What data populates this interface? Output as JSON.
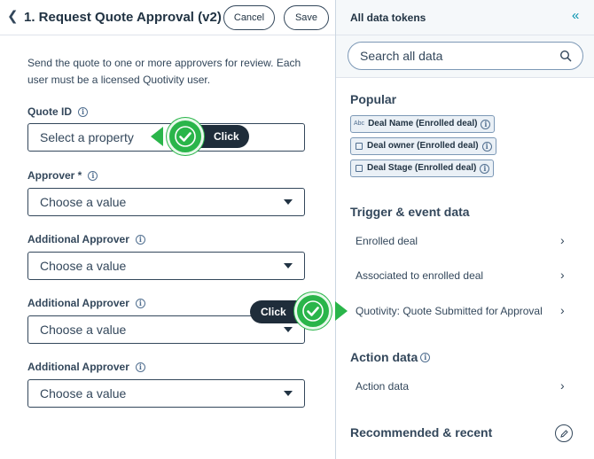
{
  "editor": {
    "title": "1. Request Quote Approval (v2)",
    "cancel_label": "Cancel",
    "save_label": "Save",
    "description": "Send the quote to one or more approvers for review. Each user must be a licensed Quotivity user.",
    "fields": [
      {
        "label": "Quote ID",
        "placeholder": "Select a property",
        "type": "property"
      },
      {
        "label": "Approver *",
        "placeholder": "Choose a value",
        "type": "dropdown"
      },
      {
        "label": "Additional Approver",
        "placeholder": "Choose a value",
        "type": "dropdown"
      },
      {
        "label": "Additional Approver",
        "placeholder": "Choose a value",
        "type": "dropdown"
      },
      {
        "label": "Additional Approver",
        "placeholder": "Choose a value",
        "type": "dropdown"
      }
    ]
  },
  "callouts": {
    "click_label": "Click"
  },
  "tokens_panel": {
    "title": "All data tokens",
    "search_placeholder": "Search all data",
    "popular": {
      "title": "Popular",
      "chips": [
        {
          "type_label": "Abc",
          "label": "Deal Name (Enrolled deal)"
        },
        {
          "type_label": "",
          "label": "Deal owner (Enrolled deal)"
        },
        {
          "type_label": "",
          "label": "Deal Stage (Enrolled deal)"
        }
      ]
    },
    "trigger": {
      "title": "Trigger & event data",
      "items": [
        {
          "label": "Enrolled deal"
        },
        {
          "label": "Associated to enrolled deal"
        },
        {
          "label": "Quotivity: Quote Submitted for Approval"
        }
      ]
    },
    "action": {
      "title": "Action data",
      "items": [
        {
          "label": "Action data"
        }
      ]
    },
    "recommended": {
      "title": "Recommended & recent"
    }
  },
  "colors": {
    "callout_green": "#2ab54a",
    "callout_dark": "#1f2d3a",
    "accent_blue": "#0091ae"
  }
}
